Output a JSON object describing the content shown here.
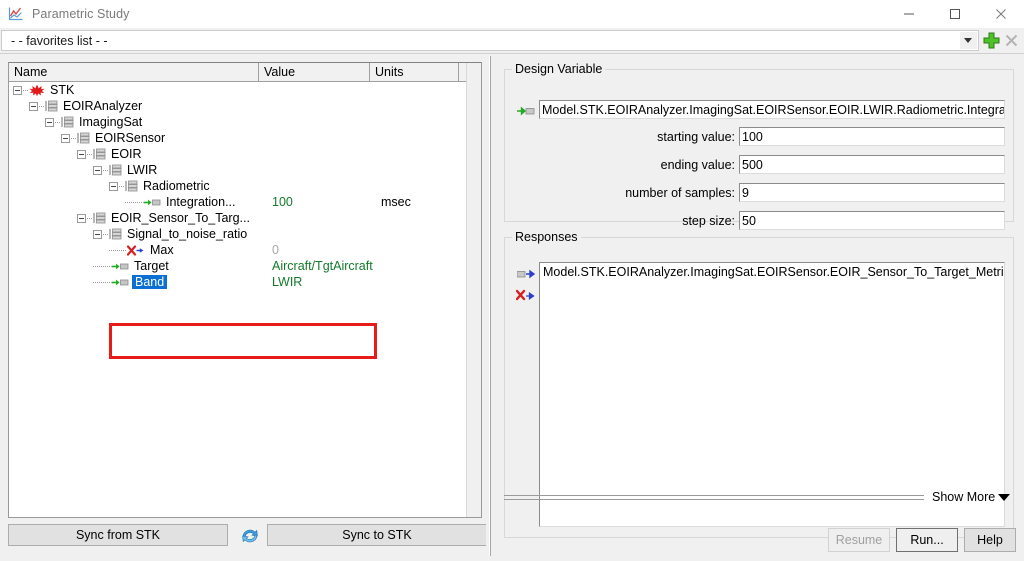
{
  "window": {
    "title": "Parametric Study",
    "icon": "chart-line-icon",
    "controls": {
      "minimize": "minimize-icon",
      "maximize": "maximize-icon",
      "close": "close-icon"
    }
  },
  "favorites": {
    "value": "- -  favorites list  - -",
    "dropdown_icon": "chevron-down-icon",
    "add_icon": "green-plus-icon",
    "remove_icon": "gray-x-icon"
  },
  "tree": {
    "columns": [
      "Name",
      "Value",
      "Units",
      ""
    ],
    "rows": [
      {
        "depth": 0,
        "label": "STK",
        "value": "",
        "units": "",
        "icon": "stk-logo-icon",
        "expander": true,
        "selected": false,
        "value_style": "green"
      },
      {
        "depth": 1,
        "label": "EOIRAnalyzer",
        "value": "",
        "units": "",
        "icon": "folder-node-icon",
        "expander": true,
        "selected": false,
        "value_style": "green"
      },
      {
        "depth": 2,
        "label": "ImagingSat",
        "value": "",
        "units": "",
        "icon": "folder-node-icon",
        "expander": true,
        "selected": false,
        "value_style": "green"
      },
      {
        "depth": 3,
        "label": "EOIRSensor",
        "value": "",
        "units": "",
        "icon": "folder-node-icon",
        "expander": true,
        "selected": false,
        "value_style": "green"
      },
      {
        "depth": 4,
        "label": "EOIR",
        "value": "",
        "units": "",
        "icon": "folder-node-icon",
        "expander": true,
        "selected": false,
        "value_style": "green"
      },
      {
        "depth": 5,
        "label": "LWIR",
        "value": "",
        "units": "",
        "icon": "folder-node-icon",
        "expander": true,
        "selected": false,
        "value_style": "green"
      },
      {
        "depth": 6,
        "label": "Radiometric",
        "value": "",
        "units": "",
        "icon": "folder-node-icon",
        "expander": true,
        "selected": false,
        "value_style": "green"
      },
      {
        "depth": 7,
        "label": "Integration...",
        "value": "100",
        "units": "msec",
        "icon": "design-variable-icon",
        "expander": false,
        "selected": false,
        "value_style": "green"
      },
      {
        "depth": 4,
        "label": "EOIR_Sensor_To_Targ...",
        "value": "",
        "units": "",
        "icon": "folder-node-icon",
        "expander": true,
        "selected": false,
        "value_style": "green"
      },
      {
        "depth": 5,
        "label": "Signal_to_noise_ratio",
        "value": "",
        "units": "",
        "icon": "folder-node-icon",
        "expander": true,
        "selected": false,
        "value_style": "green"
      },
      {
        "depth": 6,
        "label": "Max",
        "value": "0",
        "units": "",
        "icon": "response-icon",
        "expander": false,
        "selected": false,
        "value_style": "gray"
      },
      {
        "depth": 5,
        "label": "Target",
        "value": "Aircraft/TgtAircraft",
        "units": "",
        "icon": "design-variable-icon",
        "expander": false,
        "selected": false,
        "value_style": "green"
      },
      {
        "depth": 5,
        "label": "Band",
        "value": "LWIR",
        "units": "",
        "icon": "design-variable-icon",
        "expander": false,
        "selected": true,
        "value_style": "green"
      }
    ],
    "highlight_color": "#e81b1b",
    "selection_color": "#0b6fd4"
  },
  "left_buttons": {
    "sync_from_stk": "Sync from STK",
    "sync_to_stk": "Sync to STK",
    "sync_icon": "refresh-sync-icon"
  },
  "design_variable": {
    "legend": "Design Variable",
    "icon": "design-variable-icon",
    "path": "Model.STK.EOIRAnalyzer.ImagingSat.EOIRSensor.EOIR.LWIR.Radiometric.IntegrationTime",
    "fields": {
      "starting_value_label": "starting value:",
      "starting_value": "100",
      "ending_value_label": "ending value:",
      "ending_value": "500",
      "number_of_samples_label": "number of samples:",
      "number_of_samples": "9",
      "step_size_label": "step size:",
      "step_size": "50"
    }
  },
  "responses": {
    "legend": "Responses",
    "add_icon": "add-response-icon",
    "remove_icon": "remove-response-icon",
    "items": [
      "Model.STK.EOIRAnalyzer.ImagingSat.EOIRSensor.EOIR_Sensor_To_Target_Metrics.Signal_to_..."
    ]
  },
  "show_more": {
    "label": "Show More",
    "caret_icon": "caret-down-icon"
  },
  "actions": {
    "resume": "Resume",
    "run": "Run...",
    "help": "Help"
  }
}
